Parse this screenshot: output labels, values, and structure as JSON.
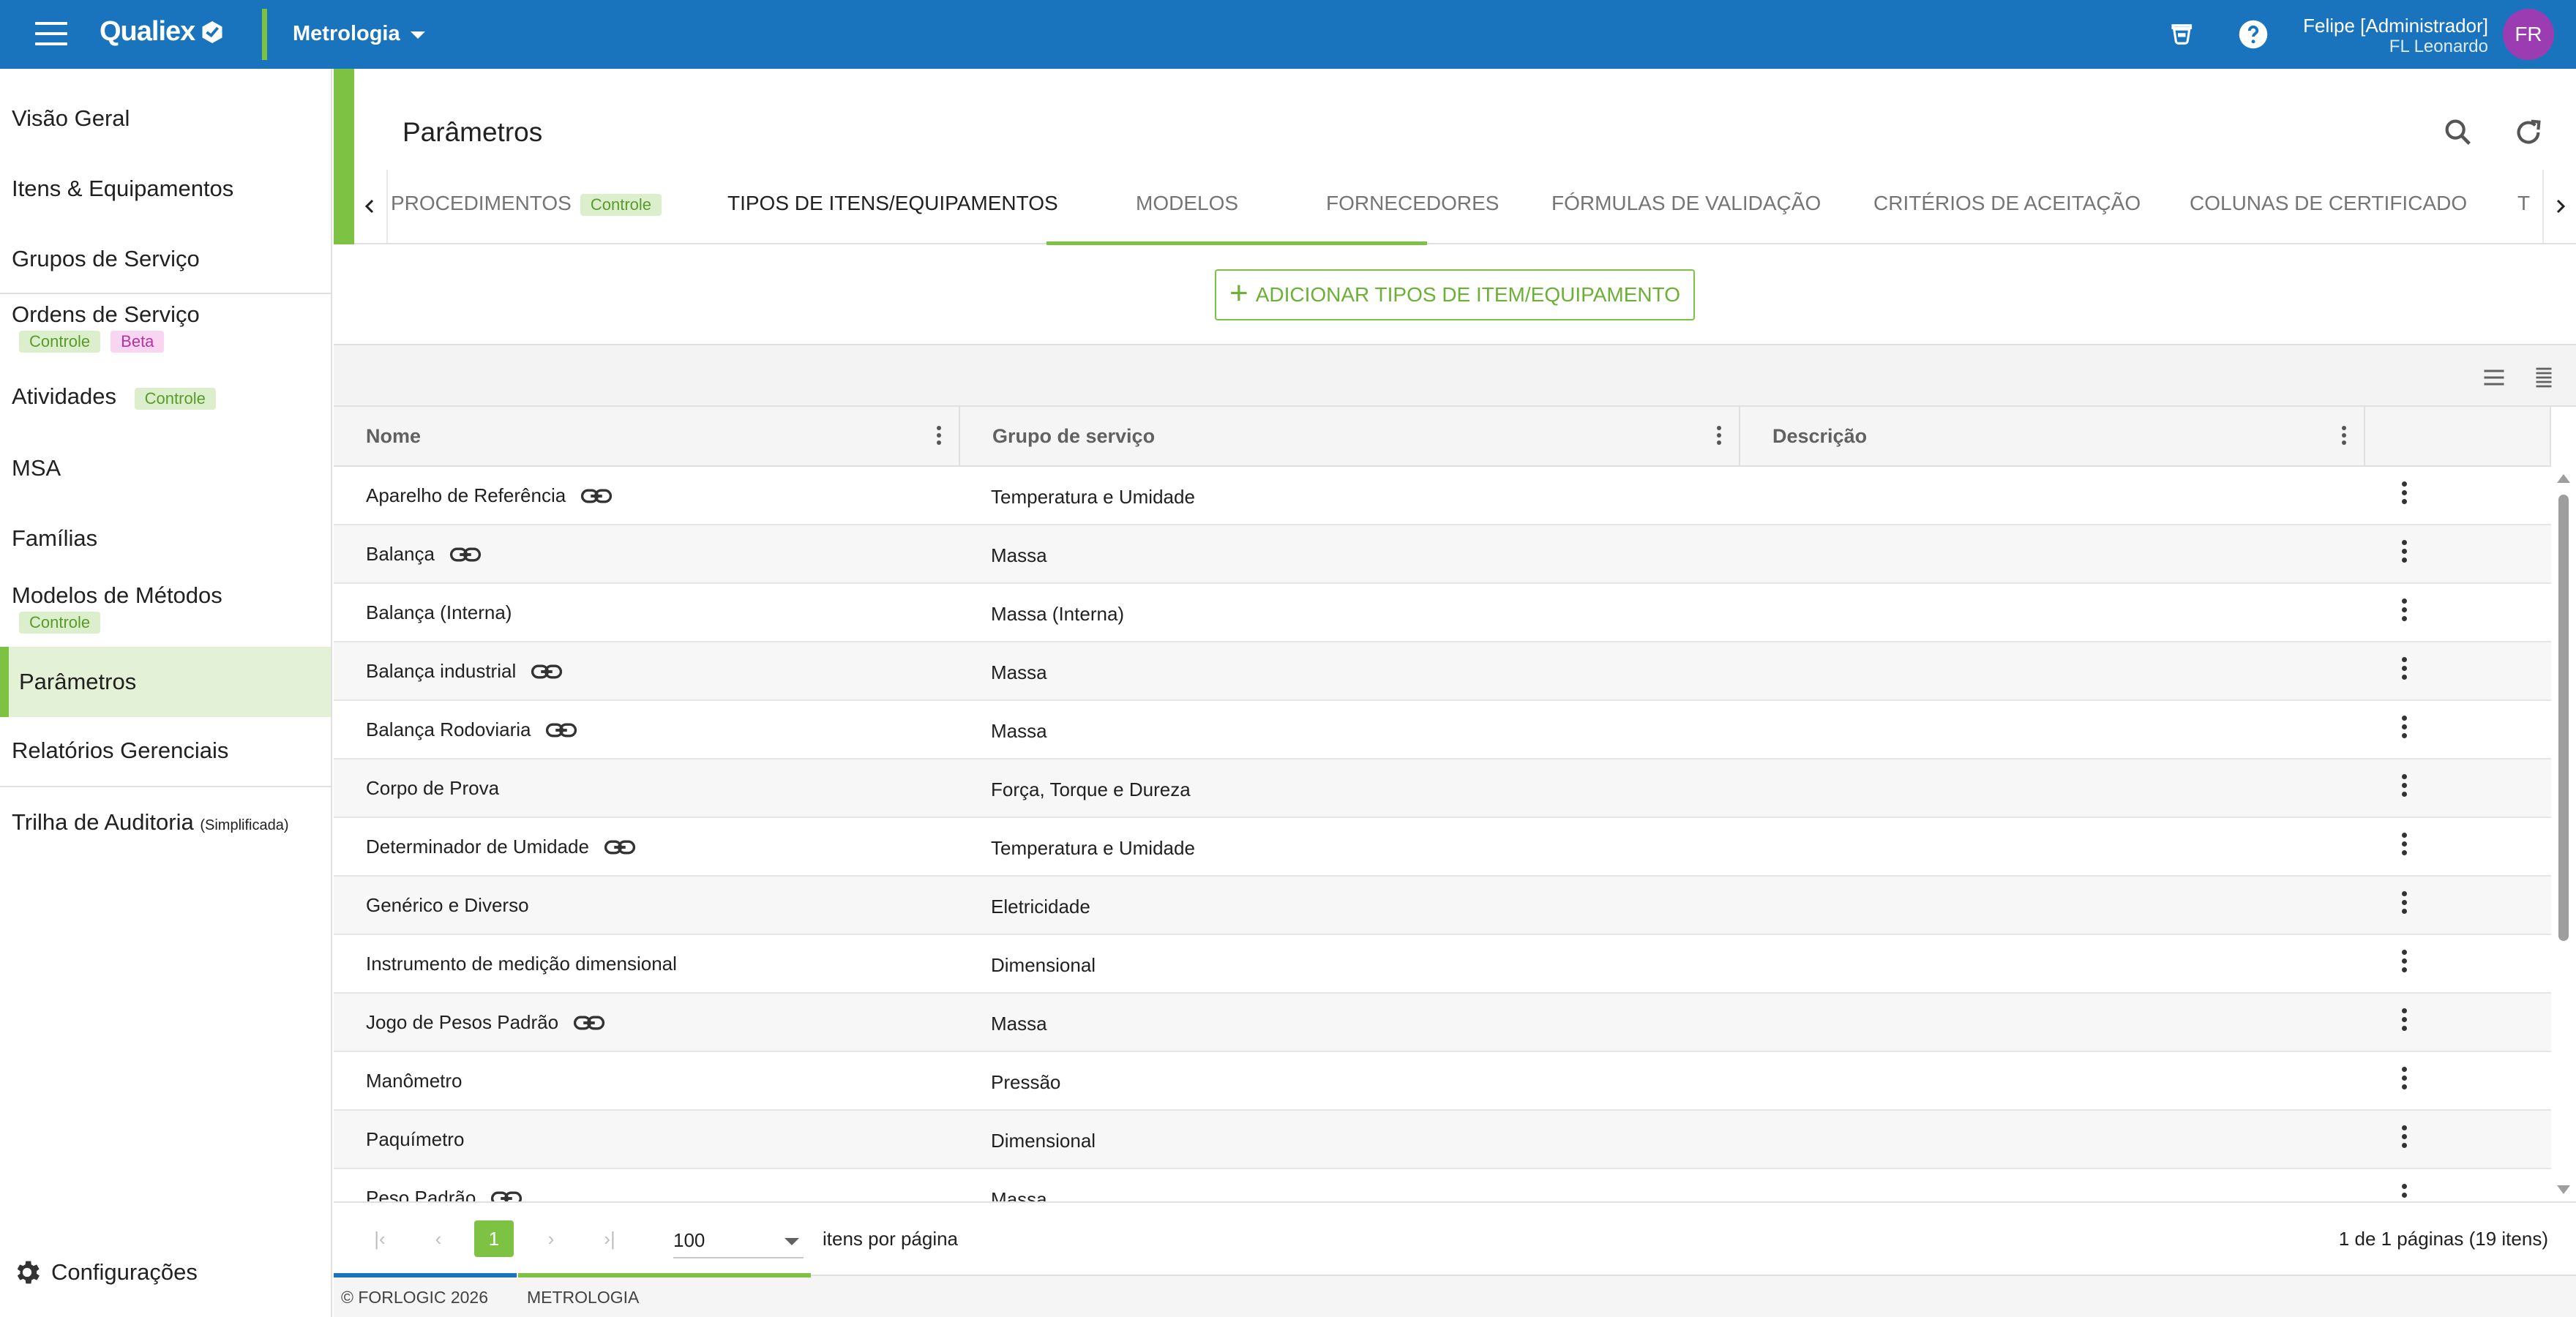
{
  "header": {
    "brand": "Qualiex",
    "module": "Metrologia",
    "user_name": "Felipe [Administrador]",
    "user_sub": "FL Leonardo",
    "avatar_initials": "FR",
    "colors": {
      "bar": "#1a74bd",
      "accent": "#7dc243",
      "avatar": "#9c3cb3"
    }
  },
  "sidebar": {
    "items": [
      {
        "label": "Visão Geral"
      },
      {
        "label": "Itens & Equipamentos"
      },
      {
        "label": "Grupos de Serviço"
      },
      {
        "label": "Ordens de Serviço",
        "badges": [
          "Controle",
          "Beta"
        ]
      },
      {
        "label": "Atividades",
        "badge": "Controle"
      },
      {
        "label": "MSA"
      },
      {
        "label": "Famílias"
      },
      {
        "label": "Modelos de Métodos",
        "badge": "Controle"
      },
      {
        "label": "Parâmetros",
        "active": true
      },
      {
        "label": "Relatórios Gerenciais"
      },
      {
        "label": "Trilha de Auditoria",
        "suffix": "(Simplificada)"
      }
    ],
    "settings_label": "Configurações"
  },
  "page": {
    "title": "Parâmetros",
    "tabs": [
      {
        "label": "PROCEDIMENTOS",
        "badge": "Controle"
      },
      {
        "label": "TIPOS DE ITENS/EQUIPAMENTOS",
        "active": true
      },
      {
        "label": "MODELOS"
      },
      {
        "label": "FORNECEDORES"
      },
      {
        "label": "FÓRMULAS DE VALIDAÇÃO"
      },
      {
        "label": "CRITÉRIOS DE ACEITAÇÃO"
      },
      {
        "label": "COLUNAS DE CERTIFICADO"
      },
      {
        "label": "T"
      }
    ],
    "add_button": "ADICIONAR TIPOS DE ITEM/EQUIPAMENTO"
  },
  "table": {
    "columns": [
      "Nome",
      "Grupo de serviço",
      "Descrição"
    ],
    "rows": [
      {
        "name": "Aparelho de Referência",
        "group": "Temperatura e Umidade",
        "link": true
      },
      {
        "name": "Balança",
        "group": "Massa",
        "link": true
      },
      {
        "name": "Balança (Interna)",
        "group": "Massa (Interna)",
        "link": false
      },
      {
        "name": "Balança industrial",
        "group": "Massa",
        "link": true
      },
      {
        "name": "Balança Rodoviaria",
        "group": "Massa",
        "link": true
      },
      {
        "name": "Corpo de Prova",
        "group": "Força, Torque e Dureza",
        "link": false
      },
      {
        "name": "Determinador de Umidade",
        "group": "Temperatura e Umidade",
        "link": true
      },
      {
        "name": "Genérico e Diverso",
        "group": "Eletricidade",
        "link": false
      },
      {
        "name": "Instrumento de medição dimensional",
        "group": "Dimensional",
        "link": false
      },
      {
        "name": "Jogo de Pesos Padrão",
        "group": "Massa",
        "link": true
      },
      {
        "name": "Manômetro",
        "group": "Pressão",
        "link": false
      },
      {
        "name": "Paquímetro",
        "group": "Dimensional",
        "link": false
      },
      {
        "name": "Peso Padrão",
        "group": "Massa",
        "link": true
      }
    ]
  },
  "pager": {
    "current_page": "1",
    "page_size": "100",
    "page_size_label": "itens por página",
    "info": "1 de 1 páginas (19 itens)"
  },
  "footer": {
    "copyright": "© FORLOGIC 2026",
    "module": "METROLOGIA"
  }
}
